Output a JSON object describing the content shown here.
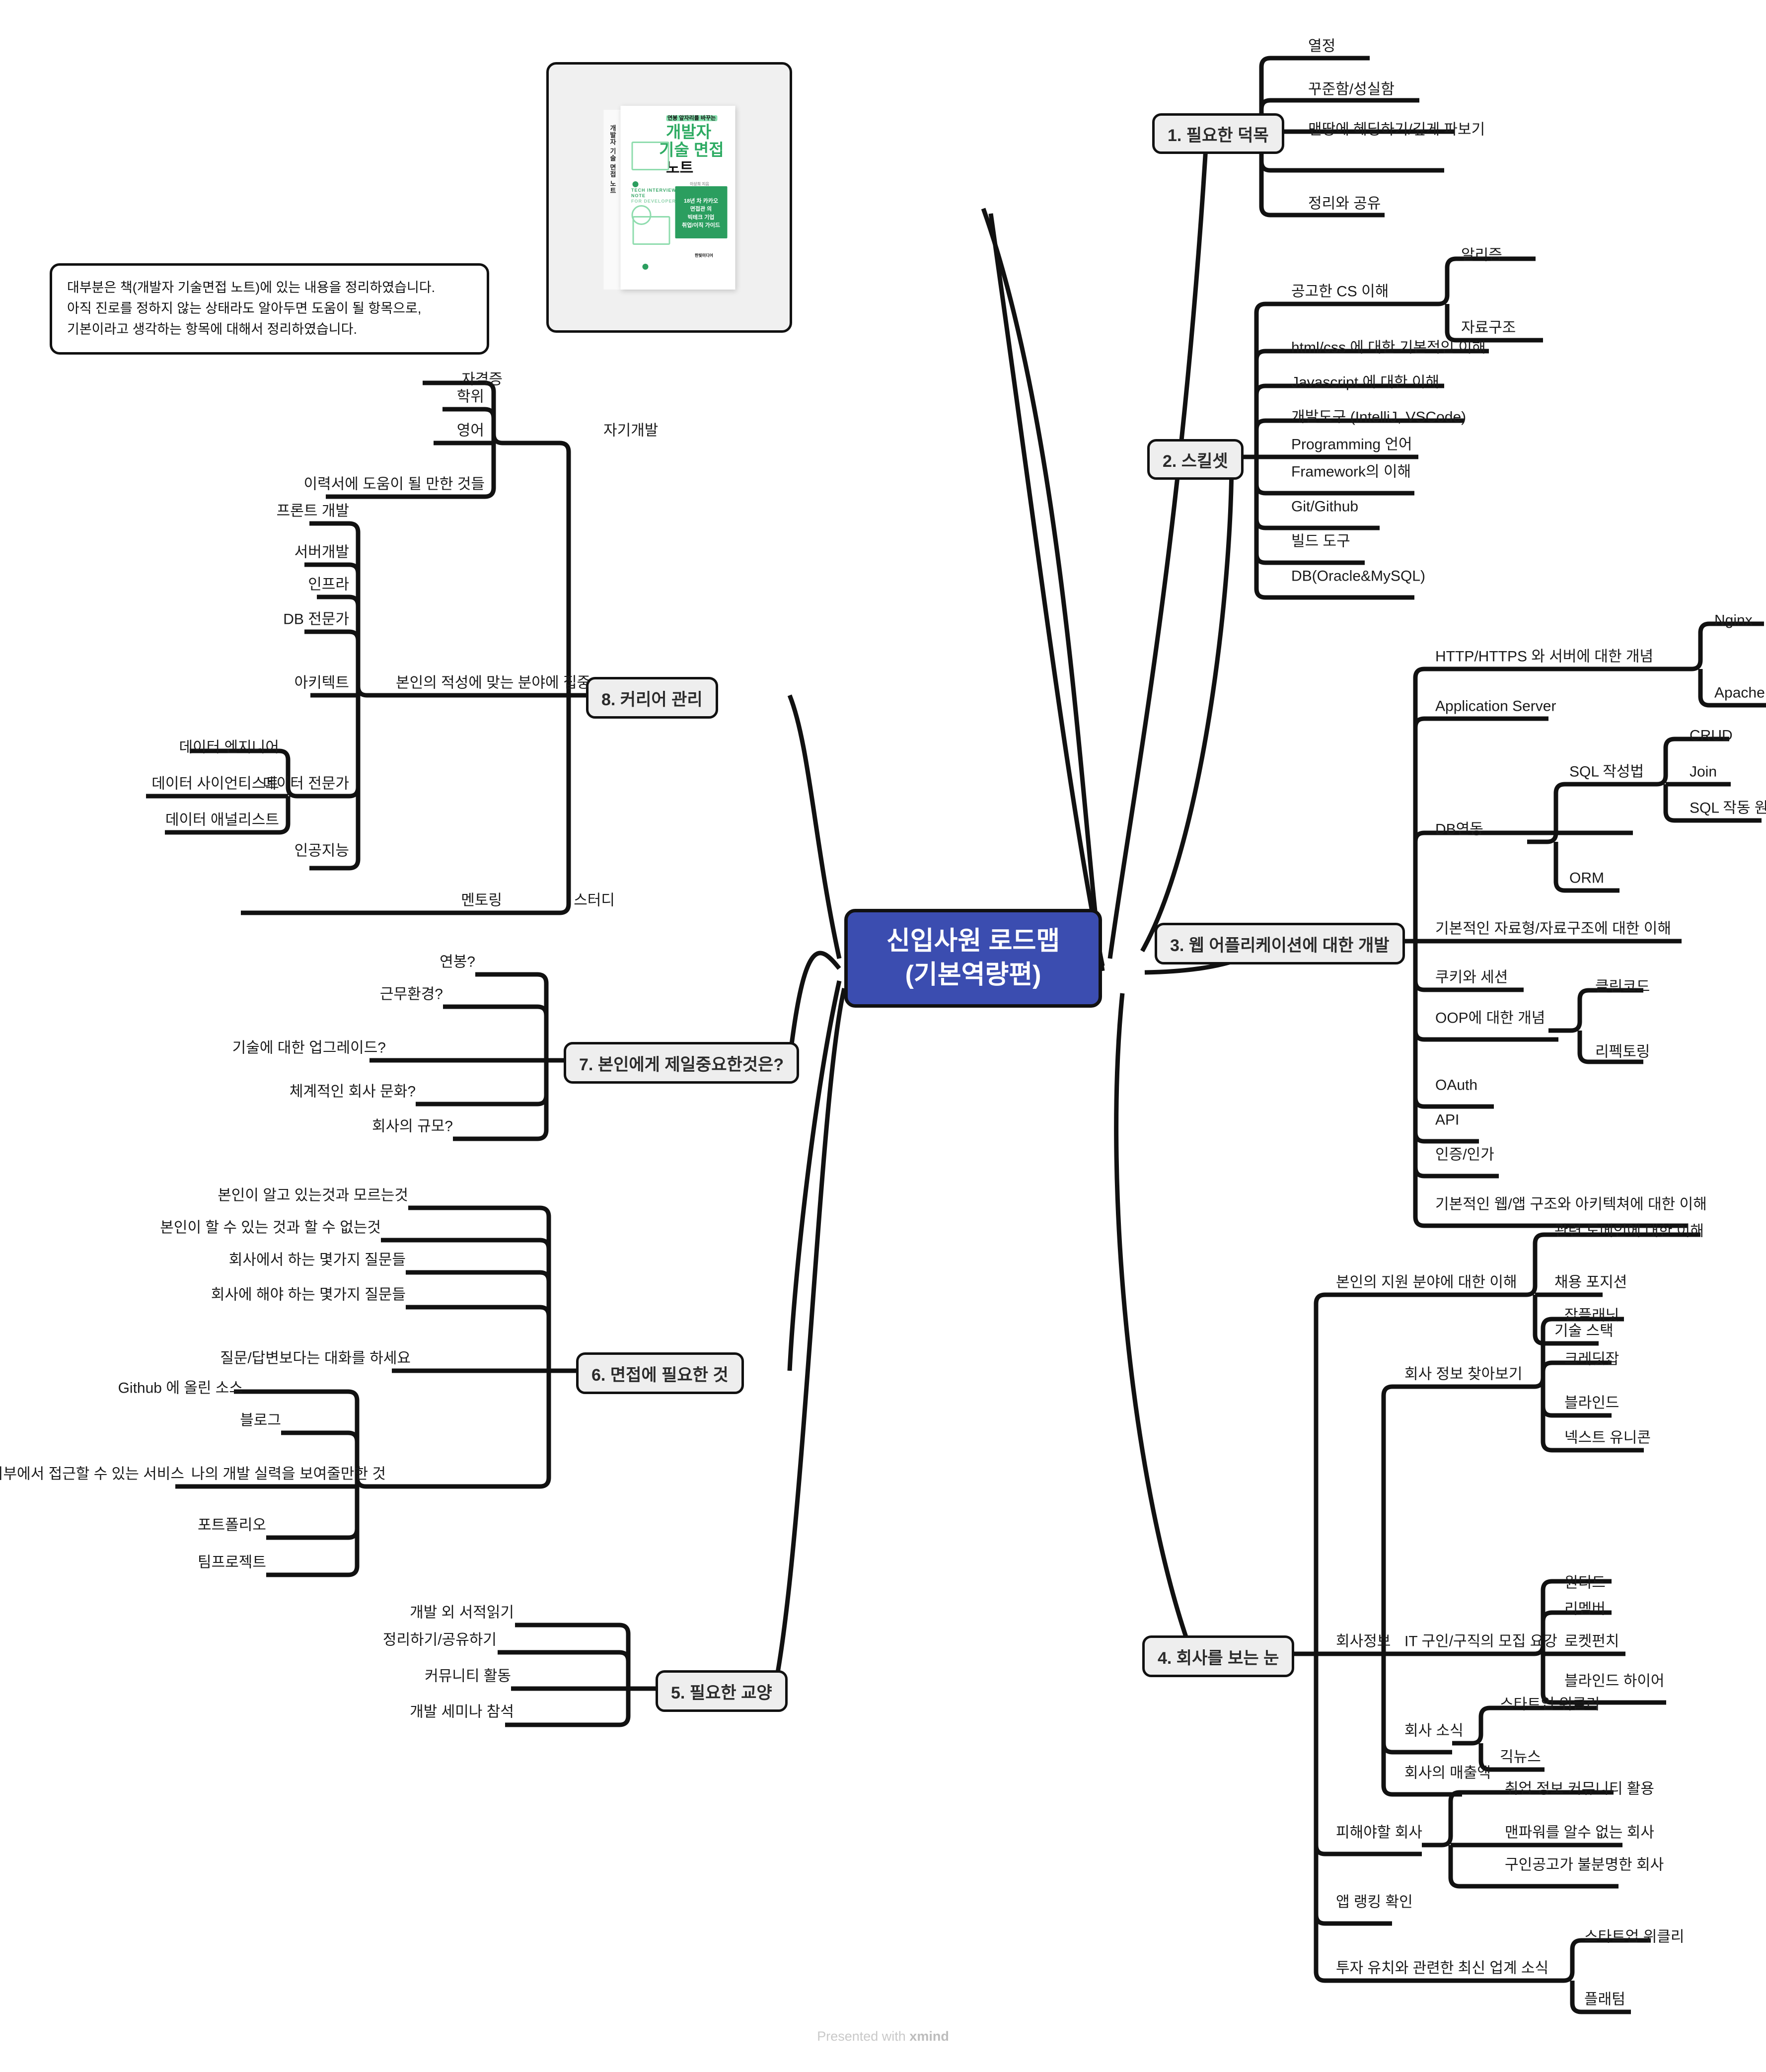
{
  "meta": {
    "footer_prefix": "Presented with ",
    "footer_brand": "xmind",
    "accent_central_bg": "#3b4db0",
    "accent_pill_bg": "#eeeeee",
    "line_color": "#111111"
  },
  "central": {
    "line1": "신입사원 로드맵",
    "line2": "(기본역량편)"
  },
  "note": {
    "line1": "대부분은 책(개발자 기술면접 노트)에 있는 내용을 정리하였습니다.",
    "line2": "아직 진로를 정하지 않는 상태라도 알아두면 도움이 될 항목으로,",
    "line3": "기본이라고 생각하는 항목에 대해서 정리하였습니다."
  },
  "book": {
    "kicker": "연봉 앞자리를 바꾸는",
    "title1": "개발자",
    "title2": "기술 면접",
    "title3": "노트",
    "author": "이상희 지음",
    "en1": "TECH INTERVIEW",
    "en2": "NOTE",
    "en3": "FOR DEVELOPERS",
    "card1": "18년 차 카카오",
    "card2": "면접관 의",
    "card3": "빅테크 기업",
    "card4": "취업/이직 가이드",
    "publisher": "한빛미디어",
    "spine": "개발자 기술 면접 노트"
  },
  "branches": [
    {
      "id": "b1",
      "label": "1. 필요한 덕목",
      "children": [
        {
          "label": "열정"
        },
        {
          "label": "꾸준함/성실함"
        },
        {
          "label": "맨땅에 헤딩하기/깊게 파보기"
        },
        {
          "label": "정리와 공유"
        }
      ]
    },
    {
      "id": "b2",
      "label": "2. 스킬셋",
      "children": [
        {
          "label": "공고한 CS 이해",
          "children": [
            {
              "label": "알리즘"
            },
            {
              "label": "자료구조"
            }
          ]
        },
        {
          "label": "html/css 에 대한 기본적인 이해"
        },
        {
          "label": "Javascript 에 대한 이해"
        },
        {
          "label": "개발도구 (IntelliJ, VSCode)"
        },
        {
          "label": "Programming 언어"
        },
        {
          "label": "Framework의 이해"
        },
        {
          "label": "Git/Github"
        },
        {
          "label": "빌드 도구"
        },
        {
          "label": "DB(Oracle&MySQL)"
        }
      ]
    },
    {
      "id": "b3",
      "label": "3. 웹 어플리케이션에 대한 개발",
      "children": [
        {
          "label": "HTTP/HTTPS 와 서버에 대한 개념",
          "children": [
            {
              "label": "Nginx"
            },
            {
              "label": "Apache"
            }
          ]
        },
        {
          "label": "Application Server"
        },
        {
          "label": "DB연동",
          "children": [
            {
              "label": "SQL 작성법",
              "children": [
                {
                  "label": "CRUD"
                },
                {
                  "label": "Join"
                },
                {
                  "label": "SQL 작동 원리"
                }
              ]
            },
            {
              "label": "ORM"
            }
          ]
        },
        {
          "label": "기본적인 자료형/자료구조에 대한 이해"
        },
        {
          "label": "쿠키와 세션"
        },
        {
          "label": "OOP에 대한 개념",
          "children": [
            {
              "label": "클린코드"
            },
            {
              "label": "리펙토링"
            }
          ]
        },
        {
          "label": "OAuth"
        },
        {
          "label": "API"
        },
        {
          "label": "인증/인가"
        },
        {
          "label": "기본적인 웹/앱 구조와 아키텍쳐에 대한 이해"
        }
      ]
    },
    {
      "id": "b4",
      "label": "4. 회사를 보는 눈",
      "children": [
        {
          "label": "본인의 지원 분야에 대한 이해",
          "children": [
            {
              "label": "관련 도메인에 대한 이해"
            },
            {
              "label": "채용 포지션"
            },
            {
              "label": "기술 스택"
            }
          ]
        },
        {
          "label": "회사정보",
          "children": [
            {
              "label": "회사 정보 찾아보기",
              "children": [
                {
                  "label": "잡플래닛"
                },
                {
                  "label": "크레딧잡"
                },
                {
                  "label": "블라인드"
                },
                {
                  "label": "넥스트 유니콘"
                }
              ]
            },
            {
              "label": "IT 구인/구직의 모집 요강",
              "children": [
                {
                  "label": "원티드"
                },
                {
                  "label": "리멤버"
                },
                {
                  "label": "로켓펀치"
                },
                {
                  "label": "블라인드 하이어"
                }
              ]
            },
            {
              "label": "회사 소식",
              "children": [
                {
                  "label": "스타트업 위클리"
                },
                {
                  "label": "긱뉴스"
                }
              ]
            },
            {
              "label": "회사의 매출액"
            }
          ]
        },
        {
          "label": "피해야할 회사",
          "children": [
            {
              "label": "취업 정보 커뮤니티 활용"
            },
            {
              "label": "맨파워를 알수 없는 회사"
            },
            {
              "label": "구인공고가 불분명한 회사"
            }
          ]
        },
        {
          "label": "앱 랭킹 확인"
        },
        {
          "label": "투자 유치와 관련한 최신 업계 소식",
          "children": [
            {
              "label": "스타트업 위클리"
            },
            {
              "label": "플래텀"
            }
          ]
        }
      ]
    },
    {
      "id": "b5",
      "label": "5. 필요한 교양",
      "children": [
        {
          "label": "개발 외 서적읽기"
        },
        {
          "label": "정리하기/공유하기"
        },
        {
          "label": "커뮤니티 활동"
        },
        {
          "label": "개발 세미나 참석"
        }
      ]
    },
    {
      "id": "b6",
      "label": "6. 면접에 필요한 것",
      "children": [
        {
          "label": "본인이 알고 있는것과 모르는것"
        },
        {
          "label": "본인이 할 수 있는 것과 할 수 없는것"
        },
        {
          "label": "회사에서 하는 몇가지 질문들"
        },
        {
          "label": "회사에 해야 하는 몇가지 질문들"
        },
        {
          "label": "질문/답변보다는 대화를 하세요"
        },
        {
          "label": "나의 개발 실력을 보여줄만한 것",
          "children": [
            {
              "label": "Github 에 올린 소스"
            },
            {
              "label": "블로그"
            },
            {
              "label": "외부에서 접근할 수 있는 서비스"
            },
            {
              "label": "포트폴리오"
            },
            {
              "label": "팀프로젝트"
            }
          ]
        }
      ]
    },
    {
      "id": "b7",
      "label": "7. 본인에게 제일중요한것은?",
      "children": [
        {
          "label": "연봉?"
        },
        {
          "label": "근무환경?"
        },
        {
          "label": "기술에 대한 업그레이드?"
        },
        {
          "label": "체계적인 회사 문화?"
        },
        {
          "label": "회사의 규모?"
        }
      ]
    },
    {
      "id": "b8",
      "label": "8. 커리어 관리",
      "children": [
        {
          "label": "자기개발",
          "children": [
            {
              "label": "자격증"
            },
            {
              "label": "학위"
            },
            {
              "label": "영어"
            },
            {
              "label": "이력서에 도움이 될 만한 것들"
            }
          ]
        },
        {
          "label": "본인의 적성에 맞는 분야에 집중",
          "children": [
            {
              "label": "프론트 개발"
            },
            {
              "label": "서버개발"
            },
            {
              "label": "인프라"
            },
            {
              "label": "DB 전문가"
            },
            {
              "label": "아키텍트"
            },
            {
              "label": "데이터 전문가",
              "children": [
                {
                  "label": "데이터 엔지니어"
                },
                {
                  "label": "데이터 사이언티스트"
                },
                {
                  "label": "데이터 애널리스트"
                }
              ]
            },
            {
              "label": "인공지능"
            }
          ]
        },
        {
          "label": "멘토링"
        },
        {
          "label": "스터디"
        }
      ]
    }
  ]
}
